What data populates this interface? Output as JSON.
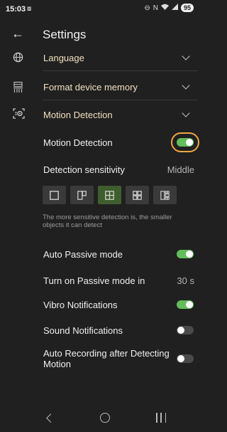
{
  "status_bar": {
    "time": "15:03",
    "cast_icon": "screen-cast-icon",
    "icons": [
      "circle-minus-icon",
      "signal-n-icon",
      "wifi-icon",
      "cellular-icon"
    ],
    "battery": "95"
  },
  "header": {
    "title": "Settings",
    "back_icon": "arrow-back-icon"
  },
  "sections": {
    "language": "Language",
    "format_memory": "Format device memory",
    "motion_detection": "Motion Detection"
  },
  "settings": {
    "motion_detection": {
      "label": "Motion Detection",
      "enabled": true
    },
    "detection_sensitivity": {
      "label": "Detection sensitivity",
      "value": "Middle",
      "levels": 5,
      "selected_index": 2,
      "hint": "The more sensitive detection is, the smaller objects it can detect"
    },
    "auto_passive": {
      "label": "Auto Passive mode",
      "enabled": true
    },
    "passive_in": {
      "label": "Turn on Passive mode in",
      "value": "30 s"
    },
    "vibro": {
      "label": "Vibro Notifications",
      "enabled": true
    },
    "sound": {
      "label": "Sound Notifications",
      "enabled": false
    },
    "auto_recording": {
      "label": "Auto Recording after Detecting Motion",
      "enabled": false
    }
  },
  "colors": {
    "background": "#202020",
    "accent_green": "#62bd5a",
    "section_text": "#f0e0bf",
    "highlight_outline": "#f0a640"
  }
}
